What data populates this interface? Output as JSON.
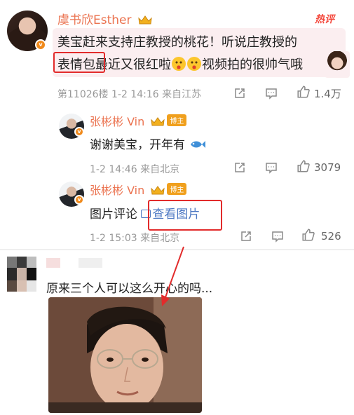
{
  "main_comment": {
    "username": "虞书欣Esther",
    "hot_tag": "热评",
    "line1": "美宝赶来支持庄教授的桃花！听说庄教授的",
    "line2_boxed": "表情包",
    "line2_rest": "最近又很红啦",
    "line2_after": "视频拍的很帅气哦",
    "floor_meta": "第11026楼 1-2 14:16 来自江苏",
    "likes": "1.4万"
  },
  "reply1": {
    "username": "张彬彬 Vin",
    "role_badge": "博主",
    "text": "谢谢美宝，开年有",
    "meta": "1-2 14:46 来自北京",
    "likes": "3079"
  },
  "reply2": {
    "username": "张彬彬 Vin",
    "role_badge": "博主",
    "text_prefix": "图片评论",
    "link_text": "查看图片",
    "meta": "1-2 15:03 来自北京",
    "likes": "526"
  },
  "bottom_post": {
    "text": "原来三个人可以这么开心的吗..."
  },
  "colors": {
    "username": "#eb7350",
    "hot": "#f4473b",
    "highlight_box": "#e22b2b",
    "link": "#4b77c2"
  }
}
